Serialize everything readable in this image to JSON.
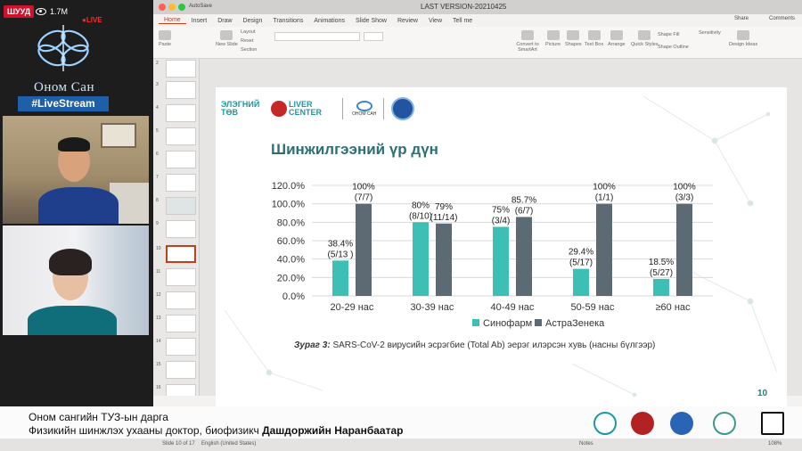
{
  "stream": {
    "badge": "ШУУД",
    "viewers": "1.7M",
    "live": "●LIVE",
    "brand": "Оном Сан",
    "hashtag": "#LiveStream"
  },
  "ppt": {
    "autosave": "AutoSave",
    "file_title": "LAST VERSION-20210425",
    "menu": [
      "Home",
      "Insert",
      "Draw",
      "Design",
      "Transitions",
      "Animations",
      "Slide Show",
      "Review",
      "View",
      "Tell me"
    ],
    "share": "Share",
    "comments": "Comments",
    "ribbon": [
      "Paste",
      "New Slide",
      "Layout",
      "Reset",
      "Section",
      "Convert to SmartArt",
      "Picture",
      "Shapes",
      "Text Box",
      "Arrange",
      "Quick Styles",
      "Shape Fill",
      "Shape Outline",
      "Sensitivity",
      "Design Ideas"
    ],
    "thumb_numbers": [
      "2",
      "3",
      "4",
      "5",
      "6",
      "7",
      "8",
      "9",
      "10",
      "11",
      "12",
      "13",
      "14",
      "15",
      "16"
    ],
    "status": "Slide 10 of 17",
    "language": "English (United States)",
    "notes": "Notes",
    "zoom": "108%"
  },
  "slide": {
    "logo_left": "ЭЛЭГНИЙ ТӨВ",
    "logo_liver": "LIVER CENTER",
    "logo_onom": "ОНОМ САН",
    "title": "Шинжилгээний үр дүн",
    "caption_bold": "Зураг 3:",
    "caption_rest": " SARS-CoV-2 вирусийн эсрэгбие (Total Ab) эерэг илэрсэн хувь (насны бүлгээр)",
    "number": "10"
  },
  "chart_data": {
    "type": "bar",
    "categories": [
      "20-29 нас",
      "30-39 нас",
      "40-49 нас",
      "50-59 нас",
      "≥60 нас"
    ],
    "ylim": [
      0,
      120
    ],
    "yticks": [
      "0.0%",
      "20.0%",
      "40.0%",
      "60.0%",
      "80.0%",
      "100.0%",
      "120.0%"
    ],
    "series": [
      {
        "name": "Синофарм",
        "color": "#3ebfb6",
        "values": [
          38.4,
          80,
          75,
          29.4,
          18.5
        ],
        "labels": [
          "38.4%",
          "80%",
          "75%",
          "29.4%",
          "18.5%"
        ],
        "sublabels": [
          "(5/13 )",
          "(8/10)",
          "(3/4)",
          "(5/17)",
          "(5/27)"
        ]
      },
      {
        "name": "АстраЗенека",
        "color": "#5b6a73",
        "values": [
          100,
          78.6,
          85.7,
          100,
          100
        ],
        "labels": [
          "100%",
          "79%",
          "85.7%",
          "100%",
          "100%"
        ],
        "sublabels": [
          "(7/7)",
          "(11/14)",
          "(6/7)",
          "(1/1)",
          "(3/3)"
        ]
      }
    ],
    "grid": true,
    "legend": "bottom"
  },
  "lower_third": {
    "line1": "Оном сангийн ТУЗ-ын дарга",
    "line2_pre": "Физикийн шинжлэх ухааны доктор, биофизикч ",
    "line2_name": "Дашдоржийн Наранбаатар"
  }
}
